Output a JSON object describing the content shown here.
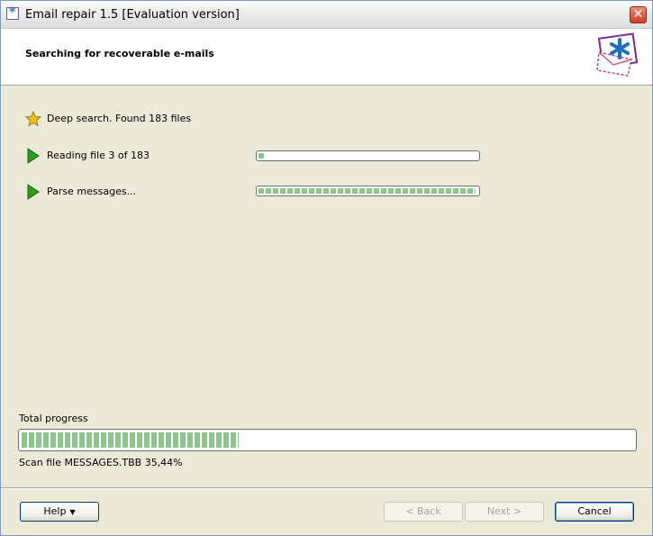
{
  "window": {
    "title": "Email repair 1.5 [Evaluation version]",
    "close_glyph": "✕"
  },
  "header": {
    "title": "Searching for recoverable e-mails"
  },
  "status": [
    {
      "icon": "star-icon",
      "text": "Deep search. Found 183 files"
    },
    {
      "icon": "play-arrow-icon",
      "text": "Reading file 3 of 183",
      "progress_percent": 2
    },
    {
      "icon": "play-arrow-icon",
      "text": "Parse messages...",
      "progress_percent": 100
    }
  ],
  "total": {
    "label": "Total progress",
    "progress_percent": 35.44,
    "status_text": "Scan file MESSAGES.TBB 35,44%"
  },
  "buttons": {
    "help": "Help",
    "help_caret": "▼",
    "back": "< Back",
    "next": "Next >",
    "cancel": "Cancel"
  },
  "colors": {
    "progress_fill": "#8cc48a",
    "play_icon": "#2e9a1e",
    "star_icon": "#f2c21a"
  }
}
